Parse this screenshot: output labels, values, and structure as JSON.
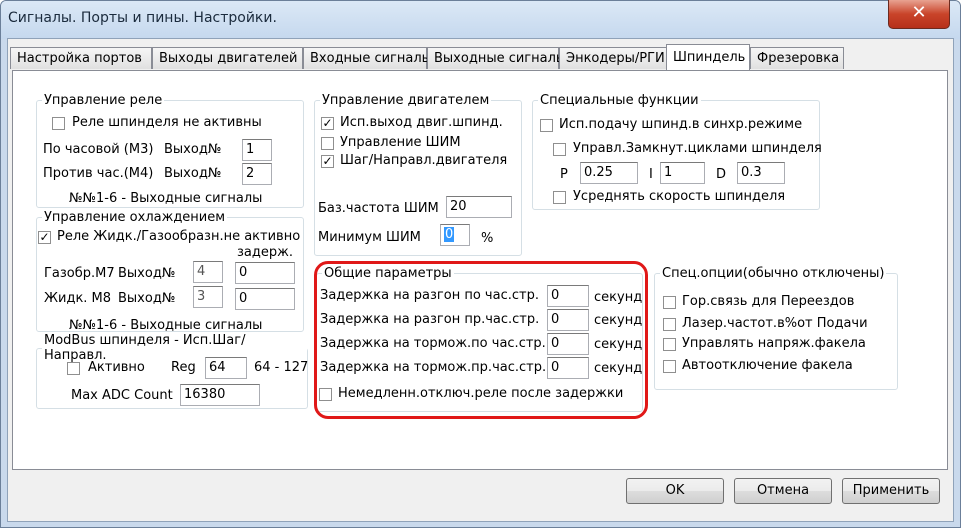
{
  "window": {
    "title": "Сигналы. Порты и пины. Настройки.",
    "close_symbol": "✕"
  },
  "tabs": [
    {
      "label": "Настройка портов"
    },
    {
      "label": "Выходы двигателей"
    },
    {
      "label": "Входные сигналы"
    },
    {
      "label": "Выходные сигналы"
    },
    {
      "label": "Энкодеры/РГИ"
    },
    {
      "label": "Шпиндель"
    },
    {
      "label": "Фрезеровка"
    }
  ],
  "relay": {
    "title": "Управление реле",
    "inactive_label": "Реле шпинделя не активны",
    "cw_label": "По часовой (М3)",
    "ccw_label": "Против час.(М4)",
    "output_label": "Выход№",
    "cw_value": "1",
    "ccw_value": "2",
    "note": "№№1-6 - Выходные сигналы"
  },
  "cooling": {
    "title": "Управление охлаждением",
    "active_label": "Реле Жидк./Газообразн.не активно",
    "delay_label": "задерж.",
    "gas_label": "Газобр.М7",
    "liquid_label": "Жидк. М8",
    "output_label": "Выход№",
    "gas_output": "4",
    "liquid_output": "3",
    "gas_delay": "0",
    "liquid_delay": "0",
    "note": "№№1-6 - Выходные сигналы"
  },
  "modbus": {
    "title": "ModBus шпинделя - Исп.Шаг/Направл.",
    "active_label": "Активно",
    "reg_label": "Reg",
    "reg_value": "64",
    "range": "64 - 127",
    "adc_label": "Max ADC Count",
    "adc_value": "16380"
  },
  "motor": {
    "title": "Управление двигателем",
    "opt1": "Исп.выход двиг.шпинд.",
    "opt2": "Управление ШИМ",
    "opt3": "Шаг/Направл.двигателя",
    "base_freq_label": "Баз.частота ШИМ",
    "base_freq_value": "20",
    "min_pwm_label": "Минимум ШИМ",
    "min_pwm_value": "0",
    "percent": "%"
  },
  "special": {
    "title": "Специальные функции",
    "sync_label": "Исп.подачу шпинд.в синхр.режиме",
    "closed_loop_label": "Управл.Замкнут.циклами шпинделя",
    "p_label": "P",
    "p_value": "0.25",
    "i_label": "I",
    "i_value": "1",
    "d_label": "D",
    "d_value": "0.3",
    "avg_label": "Усреднять скорость шпинделя"
  },
  "general": {
    "title": "Общие параметры",
    "unit": "секунд",
    "rows": [
      {
        "label": "Задержка на разгон по час.стр.",
        "value": "0"
      },
      {
        "label": "Задержка на разгон пр.час.стр.",
        "value": "0"
      },
      {
        "label": "Задержка на тормож.по час.стр.",
        "value": "0"
      },
      {
        "label": "Задержка на тормож.пр.час.стр.",
        "value": "0"
      }
    ],
    "immediate_label": "Немедленн.отключ.реле после задержки"
  },
  "spec_options": {
    "title": "Спец.опции(обычно отключены)",
    "opt1": "Гор.связь для Переездов",
    "opt2": "Лазер.частот.в%от Подачи",
    "opt3": "Управлять напряж.факела",
    "opt4": "Автоотключение факела"
  },
  "buttons": {
    "ok": "OK",
    "cancel": "Отмена",
    "apply": "Применить"
  },
  "check_glyph": "✓",
  "colors": {
    "highlight": "#e01818",
    "selection": "#3399ff"
  }
}
